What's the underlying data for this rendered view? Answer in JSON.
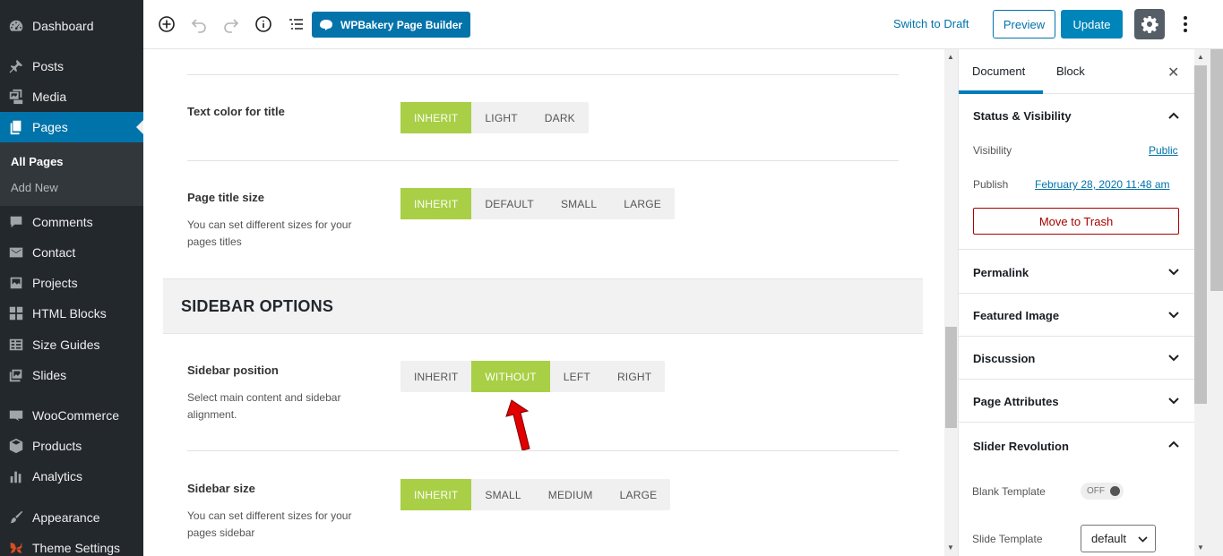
{
  "admin_menu": {
    "items": [
      {
        "label": "Dashboard",
        "icon": "dashboard-icon"
      },
      {
        "label": "Posts",
        "icon": "pin-icon"
      },
      {
        "label": "Media",
        "icon": "media-icon"
      },
      {
        "label": "Pages",
        "icon": "pages-icon"
      },
      {
        "label": "Comments",
        "icon": "comments-icon"
      },
      {
        "label": "Contact",
        "icon": "mail-icon"
      },
      {
        "label": "Projects",
        "icon": "portfolio-icon"
      },
      {
        "label": "HTML Blocks",
        "icon": "grid-icon"
      },
      {
        "label": "Size Guides",
        "icon": "table-icon"
      },
      {
        "label": "Slides",
        "icon": "slides-icon"
      },
      {
        "label": "WooCommerce",
        "icon": "woocommerce-icon"
      },
      {
        "label": "Products",
        "icon": "box-icon"
      },
      {
        "label": "Analytics",
        "icon": "bar-chart-icon"
      },
      {
        "label": "Appearance",
        "icon": "brush-icon"
      },
      {
        "label": "Theme Settings",
        "icon": "theme-settings-icon"
      }
    ],
    "submenu": {
      "all_pages": "All Pages",
      "add_new": "Add New"
    }
  },
  "toolbar": {
    "wpbakery_label": "WPBakery Page Builder",
    "switch_to_draft": "Switch to Draft",
    "preview": "Preview",
    "update": "Update"
  },
  "options": {
    "text_color_title": {
      "label": "Text color for title",
      "choices": [
        "INHERIT",
        "LIGHT",
        "DARK"
      ],
      "selected": "INHERIT"
    },
    "page_title_size": {
      "label": "Page title size",
      "description": "You can set different sizes for your pages titles",
      "choices": [
        "INHERIT",
        "DEFAULT",
        "SMALL",
        "LARGE"
      ],
      "selected": "INHERIT"
    },
    "section_heading": "SIDEBAR OPTIONS",
    "sidebar_position": {
      "label": "Sidebar position",
      "description": "Select main content and sidebar alignment.",
      "choices": [
        "INHERIT",
        "WITHOUT",
        "LEFT",
        "RIGHT"
      ],
      "selected": "WITHOUT"
    },
    "sidebar_size": {
      "label": "Sidebar size",
      "description": "You can set different sizes for your pages sidebar",
      "choices": [
        "INHERIT",
        "SMALL",
        "MEDIUM",
        "LARGE"
      ],
      "selected": "INHERIT"
    }
  },
  "panel": {
    "tabs": {
      "document": "Document",
      "block": "Block"
    },
    "status_visibility": {
      "title": "Status & Visibility",
      "visibility_label": "Visibility",
      "visibility_value": "Public",
      "publish_label": "Publish",
      "publish_value": "February 28, 2020 11:48 am",
      "trash": "Move to Trash"
    },
    "sections": {
      "permalink": "Permalink",
      "featured_image": "Featured Image",
      "discussion": "Discussion",
      "page_attributes": "Page Attributes",
      "slider_revolution": "Slider Revolution"
    },
    "slider": {
      "blank_template_label": "Blank Template",
      "blank_template_toggle": "OFF",
      "slide_template_label": "Slide Template",
      "slide_template_value": "default"
    }
  },
  "colors": {
    "admin_bg": "#23282d",
    "admin_current": "#0073aa",
    "segment_active": "#a8cf45",
    "primary_blue": "#0085ba",
    "trash_red": "#aa0000",
    "annotation_arrow": "#e00000"
  }
}
